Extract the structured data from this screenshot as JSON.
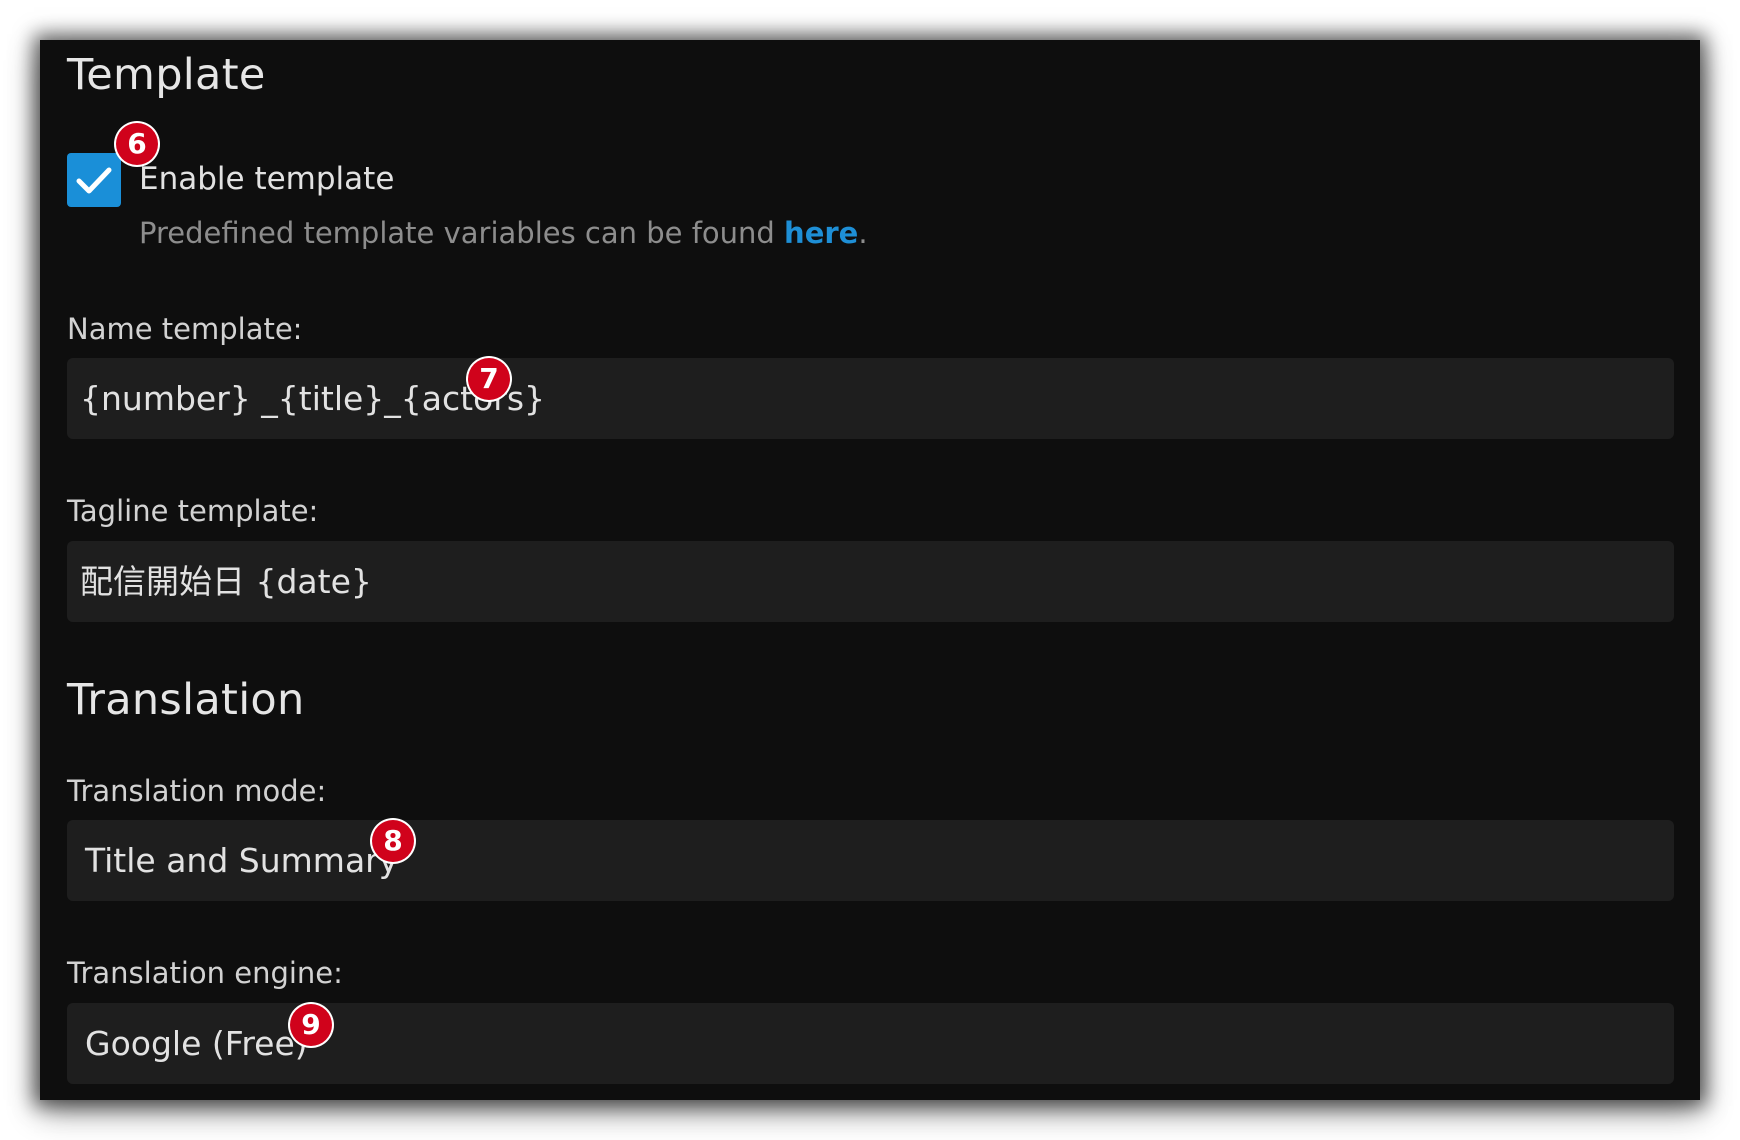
{
  "template_section": {
    "title": "Template",
    "enable_template": {
      "label": "Enable template",
      "checked": true
    },
    "help_text_prefix": "Predefined template variables can be found ",
    "help_link": "here",
    "help_text_suffix": ".",
    "name_template": {
      "label": "Name template:",
      "value": "{number} _{title}_{actors}"
    },
    "tagline_template": {
      "label": "Tagline template:",
      "value": "配信開始日 {date}"
    }
  },
  "translation_section": {
    "title": "Translation",
    "mode": {
      "label": "Translation mode:",
      "value": "Title and Summary"
    },
    "engine": {
      "label": "Translation engine:",
      "value": "Google (Free)"
    }
  },
  "annotations": {
    "badge_6": "6",
    "badge_7": "7",
    "badge_8": "8",
    "badge_9": "9"
  },
  "colors": {
    "background": "#0e0e0e",
    "field": "#1e1e1e",
    "accent": "#1a8fd8",
    "badge": "#d0021b"
  }
}
